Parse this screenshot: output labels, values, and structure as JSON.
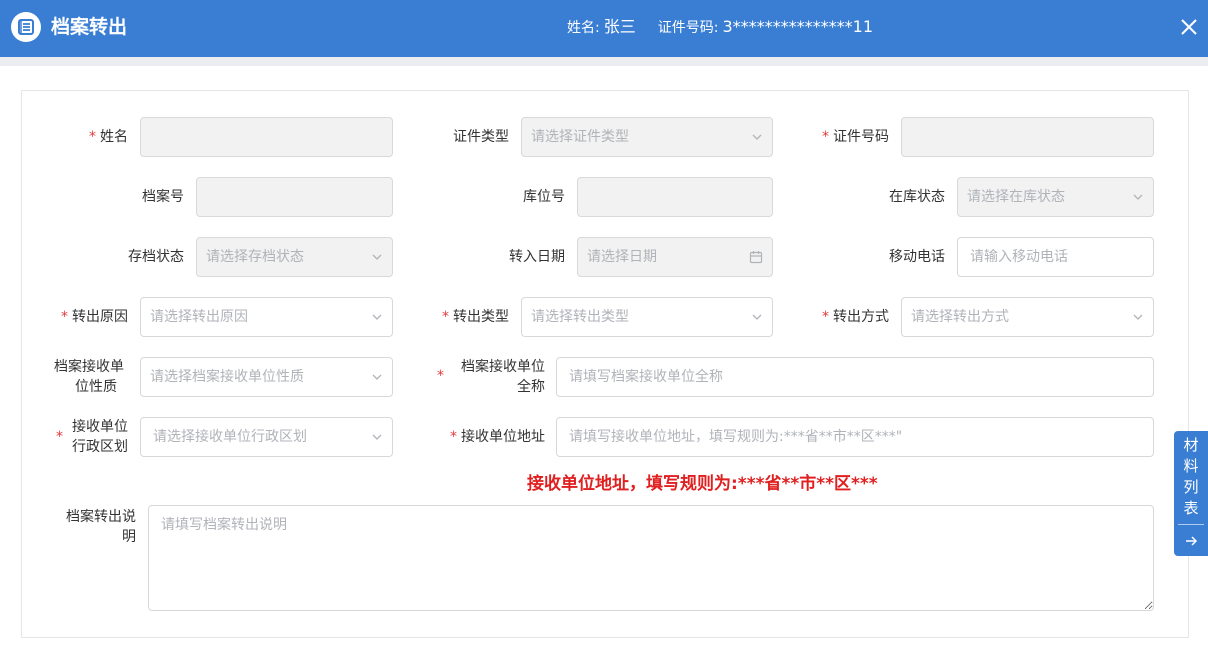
{
  "header": {
    "title": "档案转出",
    "name_label": "姓名:",
    "name_value": "张三",
    "id_label": "证件号码:",
    "id_value": "3***************11"
  },
  "form": {
    "name": {
      "label": "姓名"
    },
    "id_type": {
      "label": "证件类型",
      "placeholder": "请选择证件类型"
    },
    "id_number": {
      "label": "证件号码"
    },
    "archive_no": {
      "label": "档案号"
    },
    "location_no": {
      "label": "库位号"
    },
    "storage_status": {
      "label": "在库状态",
      "placeholder": "请选择在库状态"
    },
    "archive_status": {
      "label": "存档状态",
      "placeholder": "请选择存档状态"
    },
    "transfer_in_date": {
      "label": "转入日期",
      "placeholder": "请选择日期"
    },
    "mobile": {
      "label": "移动电话",
      "placeholder": "请输入移动电话"
    },
    "transfer_reason": {
      "label": "转出原因",
      "placeholder": "请选择转出原因"
    },
    "transfer_type": {
      "label": "转出类型",
      "placeholder": "请选择转出类型"
    },
    "transfer_method": {
      "label": "转出方式",
      "placeholder": "请选择转出方式"
    },
    "receiver_nature": {
      "label_line1": "档案接收单",
      "label_line2": "位性质",
      "placeholder": "请选择档案接收单位性质"
    },
    "receiver_fullname": {
      "label_line1": "档案接收单位",
      "label_line2": "全称",
      "placeholder": "请填写档案接收单位全称"
    },
    "receiver_region": {
      "label_line1": "接收单位",
      "label_line2": "行政区划",
      "placeholder": "请选择接收单位行政区划"
    },
    "receiver_address": {
      "label": "接收单位地址",
      "placeholder": "请填写接收单位地址，填写规则为:***省**市**区***\""
    },
    "address_hint": "接收单位地址，填写规则为:***省**市**区***",
    "remark": {
      "label_line1": "档案转出说",
      "label_line2": "明",
      "placeholder": "请填写档案转出说明"
    }
  },
  "required_mark": "*",
  "side_tab": {
    "label": "材料列表"
  },
  "colors": {
    "primary": "#3a7ed4",
    "required": "#e4393c",
    "hint": "#e02020"
  },
  "icons": {
    "logo": "list-doc-icon",
    "close": "close-icon",
    "chevron": "chevron-down-icon",
    "calendar": "calendar-icon",
    "arrow": "arrow-right-icon"
  }
}
